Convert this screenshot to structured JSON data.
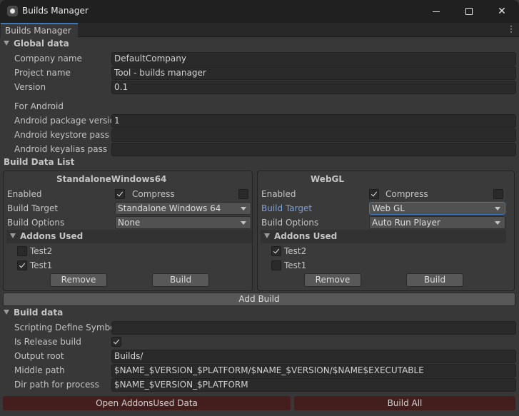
{
  "window": {
    "title": "Builds Manager",
    "icon": "unity-icon",
    "controls": [
      "minimize",
      "maximize",
      "close"
    ]
  },
  "tab": {
    "label": "Builds Manager",
    "menu_icon": "kebab-menu-icon"
  },
  "global_data": {
    "header": "Global data",
    "company_name": {
      "label": "Company name",
      "value": "DefaultCompany"
    },
    "project_name": {
      "label": "Project name",
      "value": "Tool - builds manager"
    },
    "version": {
      "label": "Version",
      "value": "0.1"
    },
    "for_android": "For Android",
    "android_package_version": {
      "label": "Android package versio",
      "value": "1"
    },
    "android_keystore_pass": {
      "label": "Android keystore pass",
      "value": ""
    },
    "android_keyalias_pass": {
      "label": "Android keyalias pass",
      "value": ""
    }
  },
  "build_data_list": {
    "header": "Build Data List",
    "builds": [
      {
        "title": "StandaloneWindows64",
        "enabled_label": "Enabled",
        "enabled": true,
        "compress_label": "Compress",
        "compress": false,
        "build_target_label": "Build Target",
        "build_target": "Standalone Windows 64",
        "build_options_label": "Build Options",
        "build_options": "None",
        "addons_header": "Addons Used",
        "addons": [
          {
            "name": "Test2",
            "checked": false
          },
          {
            "name": "Test1",
            "checked": true
          }
        ],
        "remove_label": "Remove",
        "build_label": "Build"
      },
      {
        "title": "WebGL",
        "enabled_label": "Enabled",
        "enabled": true,
        "compress_label": "Compress",
        "compress": false,
        "build_target_label": "Build Target",
        "build_target": "Web GL",
        "build_options_label": "Build Options",
        "build_options": "Auto Run Player",
        "addons_header": "Addons Used",
        "addons": [
          {
            "name": "Test2",
            "checked": true
          },
          {
            "name": "Test1",
            "checked": false
          }
        ],
        "remove_label": "Remove",
        "build_label": "Build"
      }
    ],
    "add_build_label": "Add Build"
  },
  "build_data": {
    "header": "Build data",
    "scripting_define": {
      "label": "Scripting Define Symbo",
      "value": ""
    },
    "is_release": {
      "label": "Is Release build",
      "checked": true
    },
    "output_root": {
      "label": "Output root",
      "value": "Builds/"
    },
    "middle_path": {
      "label": "Middle path",
      "value": "$NAME_$VERSION_$PLATFORM/$NAME_$VERSION/$NAME$EXECUTABLE"
    },
    "dir_path": {
      "label": "Dir path for process",
      "value": "$NAME_$VERSION_$PLATFORM"
    }
  },
  "footer": {
    "open_addons_label": "Open AddonsUsed Data",
    "build_all_label": "Build All"
  },
  "colors": {
    "accent": "#3a79bb",
    "focus_label": "#7ba0d8",
    "danger_button": "#441d1d",
    "background": "#383838"
  }
}
